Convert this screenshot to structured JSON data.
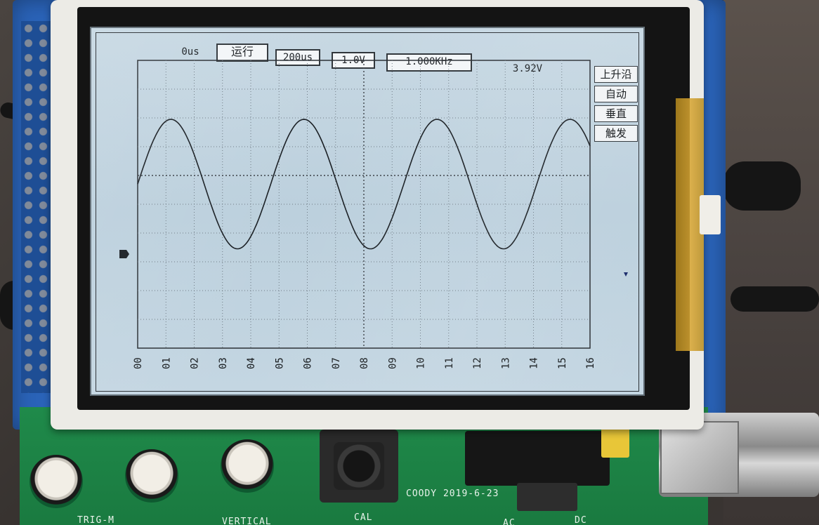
{
  "scope": {
    "time_position": "0us",
    "run_state": "运行",
    "timebase": "200us",
    "volts_per_div": "1.0V",
    "frequency": "1.000KHz",
    "amplitude": "3.92V",
    "side_buttons": [
      "上升沿",
      "自动",
      "垂直",
      "触发"
    ],
    "x_ticks": [
      "00",
      "01",
      "02",
      "03",
      "04",
      "05",
      "06",
      "07",
      "08",
      "09",
      "10",
      "11",
      "12",
      "13",
      "14",
      "15",
      "16"
    ]
  },
  "board": {
    "labels": {
      "trig": "TRIG-M",
      "vertical": "VERTICAL",
      "cal": "CAL",
      "coody": "COODY 2019-6-23",
      "ac": "AC",
      "dc": "DC"
    }
  },
  "colors": {
    "lcd_bg": "#c4d6e2",
    "trace": "#1a1f24",
    "board_blue": "#2a63b8",
    "board_green": "#1f8a4a"
  },
  "waveform": {
    "type": "sine",
    "cycles_visible": 3.4,
    "frequency_label": "1.000KHz"
  }
}
